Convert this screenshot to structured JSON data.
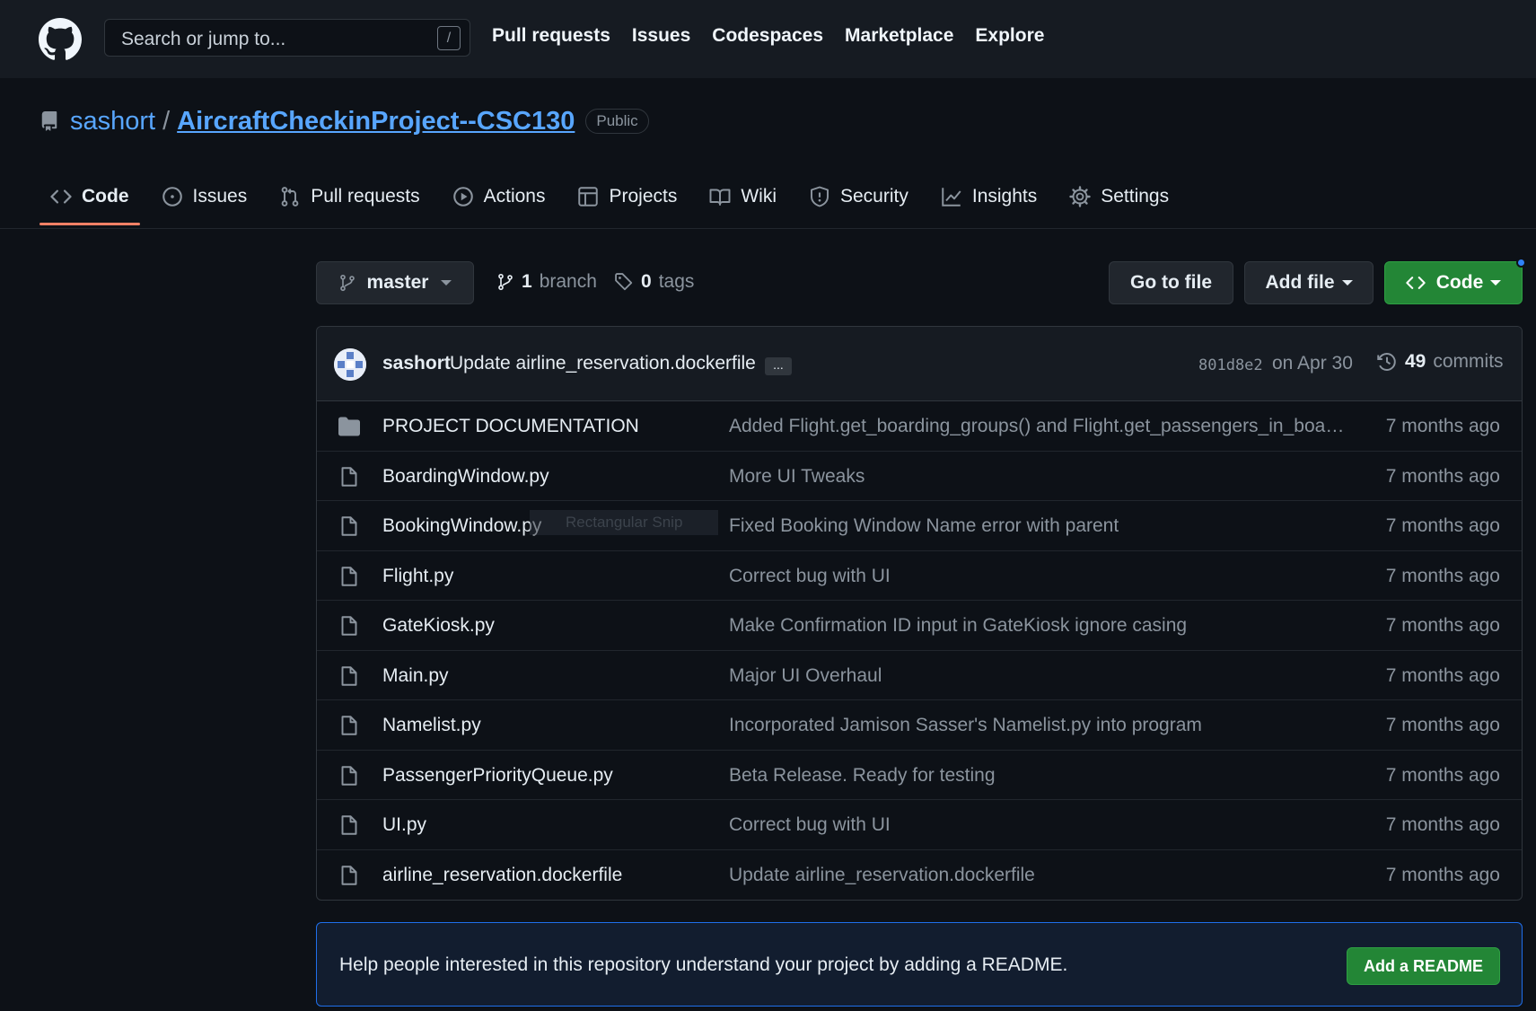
{
  "header": {
    "search_placeholder": "Search or jump to...",
    "search_shortcut": "/",
    "nav": [
      "Pull requests",
      "Issues",
      "Codespaces",
      "Marketplace",
      "Explore"
    ]
  },
  "repo": {
    "owner": "sashort",
    "separator": "/",
    "name": "AircraftCheckinProject--CSC130",
    "visibility": "Public"
  },
  "tabs": [
    {
      "label": "Code",
      "icon": "code-icon",
      "active": true
    },
    {
      "label": "Issues",
      "icon": "issue-icon"
    },
    {
      "label": "Pull requests",
      "icon": "pull-request-icon"
    },
    {
      "label": "Actions",
      "icon": "play-icon"
    },
    {
      "label": "Projects",
      "icon": "table-icon"
    },
    {
      "label": "Wiki",
      "icon": "book-icon"
    },
    {
      "label": "Security",
      "icon": "shield-icon"
    },
    {
      "label": "Insights",
      "icon": "graph-icon"
    },
    {
      "label": "Settings",
      "icon": "gear-icon"
    }
  ],
  "toolbar": {
    "branch": "master",
    "branch_count": "1",
    "branch_label": "branch",
    "tag_count": "0",
    "tag_label": "tags",
    "go_to_file": "Go to file",
    "add_file": "Add file",
    "code": "Code"
  },
  "latest_commit": {
    "author": "sashort",
    "message": "Update airline_reservation.dockerfile",
    "ellipsis": "...",
    "sha": "801d8e2",
    "date": "on Apr 30",
    "commit_count": "49",
    "commit_label": "commits"
  },
  "files": [
    {
      "type": "folder",
      "name": "PROJECT DOCUMENTATION",
      "message": "Added Flight.get_boarding_groups() and Flight.get_passengers_in_board...",
      "age": "7 months ago"
    },
    {
      "type": "file",
      "name": "BoardingWindow.py",
      "message": "More UI Tweaks",
      "age": "7 months ago"
    },
    {
      "type": "file",
      "name": "BookingWindow.py",
      "message": "Fixed Booking Window Name error with parent",
      "age": "7 months ago"
    },
    {
      "type": "file",
      "name": "Flight.py",
      "message": "Correct bug with UI",
      "age": "7 months ago"
    },
    {
      "type": "file",
      "name": "GateKiosk.py",
      "message": "Make Confirmation ID input in GateKiosk ignore casing",
      "age": "7 months ago"
    },
    {
      "type": "file",
      "name": "Main.py",
      "message": "Major UI Overhaul",
      "age": "7 months ago"
    },
    {
      "type": "file",
      "name": "Namelist.py",
      "message": "Incorporated Jamison Sasser's Namelist.py into program",
      "age": "7 months ago"
    },
    {
      "type": "file",
      "name": "PassengerPriorityQueue.py",
      "message": "Beta Release. Ready for testing",
      "age": "7 months ago"
    },
    {
      "type": "file",
      "name": "UI.py",
      "message": "Correct bug with UI",
      "age": "7 months ago"
    },
    {
      "type": "file",
      "name": "airline_reservation.dockerfile",
      "message": "Update airline_reservation.dockerfile",
      "age": "7 months ago"
    }
  ],
  "overlay_ghost": "Rectangular Snip",
  "readme_banner": {
    "text": "Help people interested in this repository understand your project by adding a README.",
    "button": "Add a README"
  },
  "colors": {
    "accent_blue": "#58a6ff",
    "green_button": "#238636",
    "active_tab_underline": "#f78166",
    "background": "#0d1117"
  }
}
